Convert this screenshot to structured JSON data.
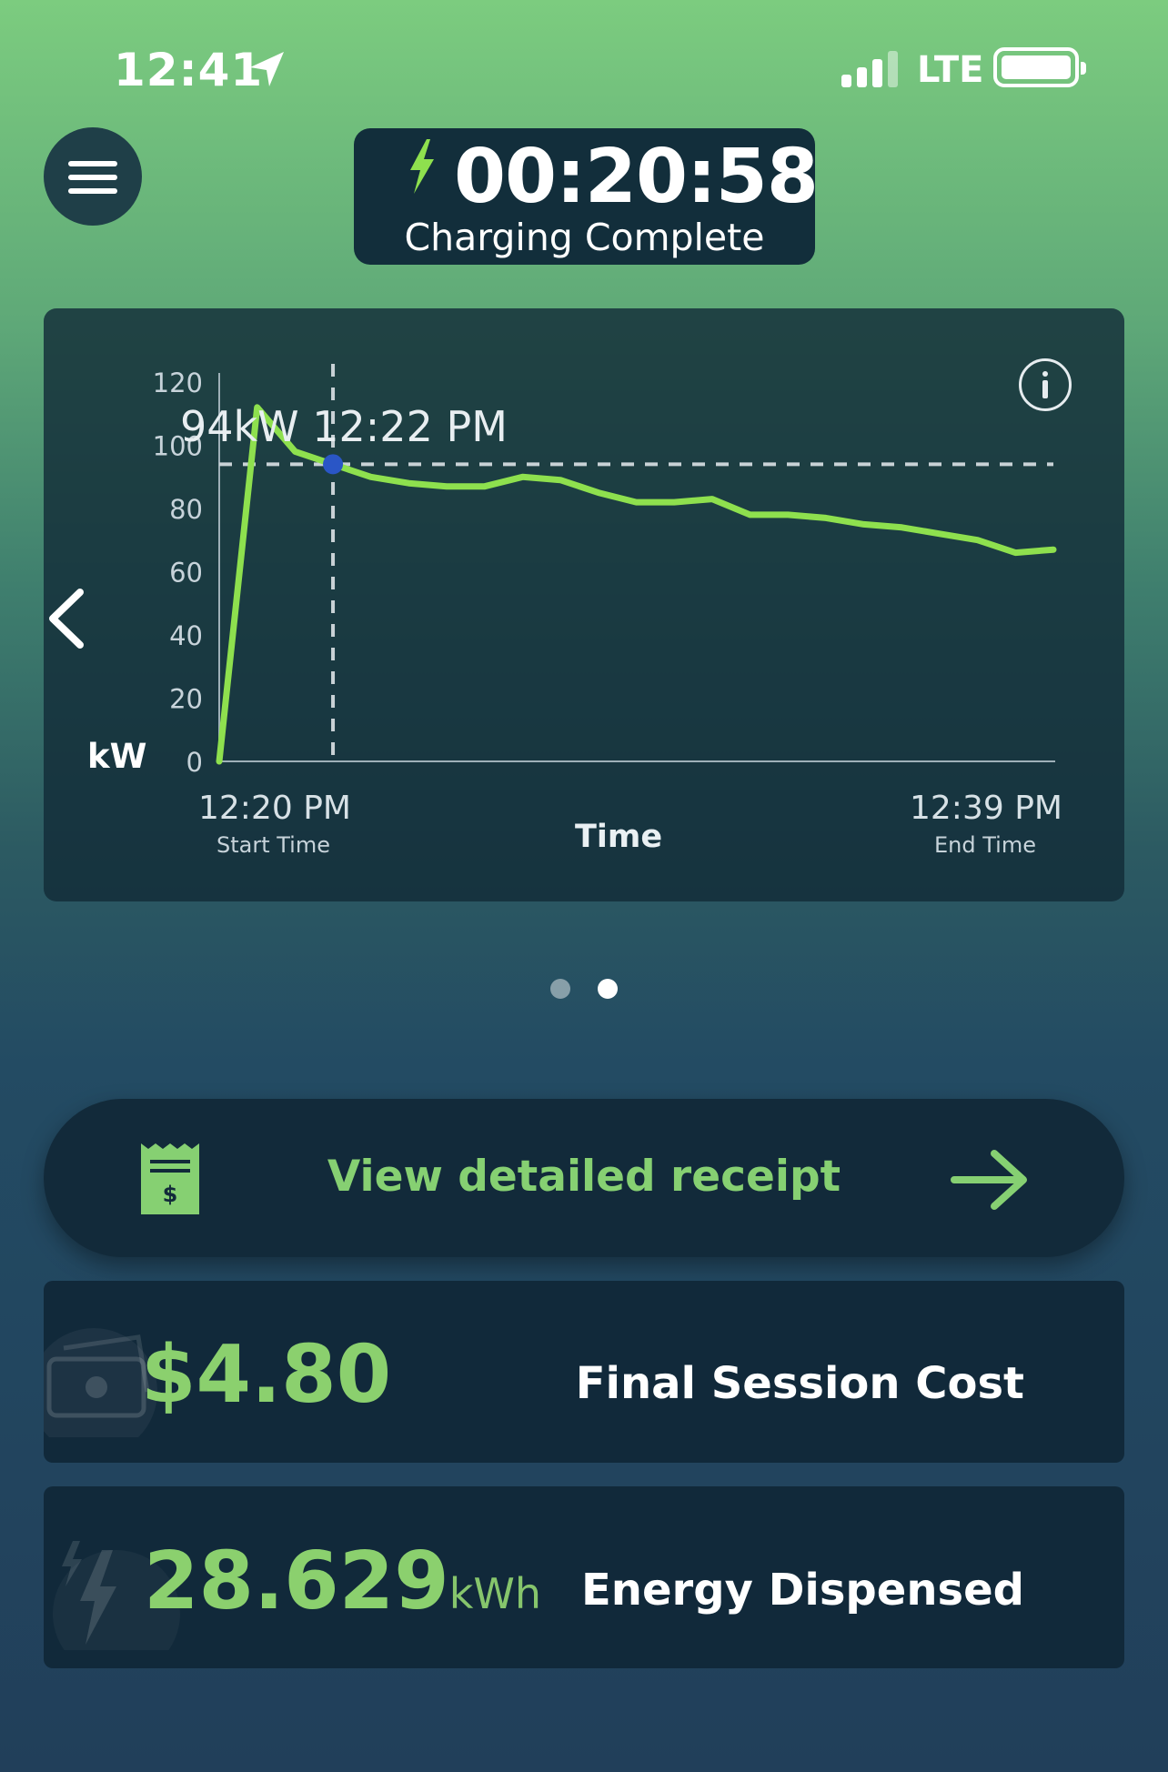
{
  "status_bar": {
    "time": "12:41",
    "network": "LTE"
  },
  "header": {
    "timer": "00:20:58",
    "status": "Charging Complete"
  },
  "chart_data": {
    "type": "line",
    "ylabel": "kW",
    "xlabel": "Time",
    "ylim": [
      0,
      120
    ],
    "yticks": [
      "120",
      "100",
      "80",
      "60",
      "40",
      "20",
      "0"
    ],
    "x_start_label": "12:20 PM",
    "x_start_caption": "Start Time",
    "x_end_label": "12:39 PM",
    "x_end_caption": "End Time",
    "series": [
      {
        "color": "#8ee04e",
        "x": [
          0,
          1,
          2,
          3,
          4,
          5,
          6,
          7,
          8,
          9,
          10,
          11,
          12,
          13,
          14,
          15,
          16,
          17,
          18,
          19,
          20,
          21,
          22
        ],
        "values": [
          0,
          112,
          98,
          94,
          90,
          88,
          87,
          87,
          90,
          89,
          85,
          82,
          82,
          83,
          78,
          78,
          77,
          75,
          74,
          72,
          70,
          66,
          67
        ]
      }
    ],
    "highlight": {
      "label": "94kW 12:22 PM",
      "x": 3,
      "value": 94
    }
  },
  "pager": {
    "count": 2,
    "active": 1
  },
  "receipt": {
    "label": "View detailed receipt"
  },
  "cost": {
    "value": "$4.80",
    "label": "Final Session Cost"
  },
  "energy": {
    "value": "28.629",
    "unit": "kWh",
    "label": "Energy Dispensed"
  },
  "colors": {
    "accent": "#8bd06e",
    "card": "#11293a",
    "line": "#8ee04e",
    "marker": "#2a56c6"
  }
}
